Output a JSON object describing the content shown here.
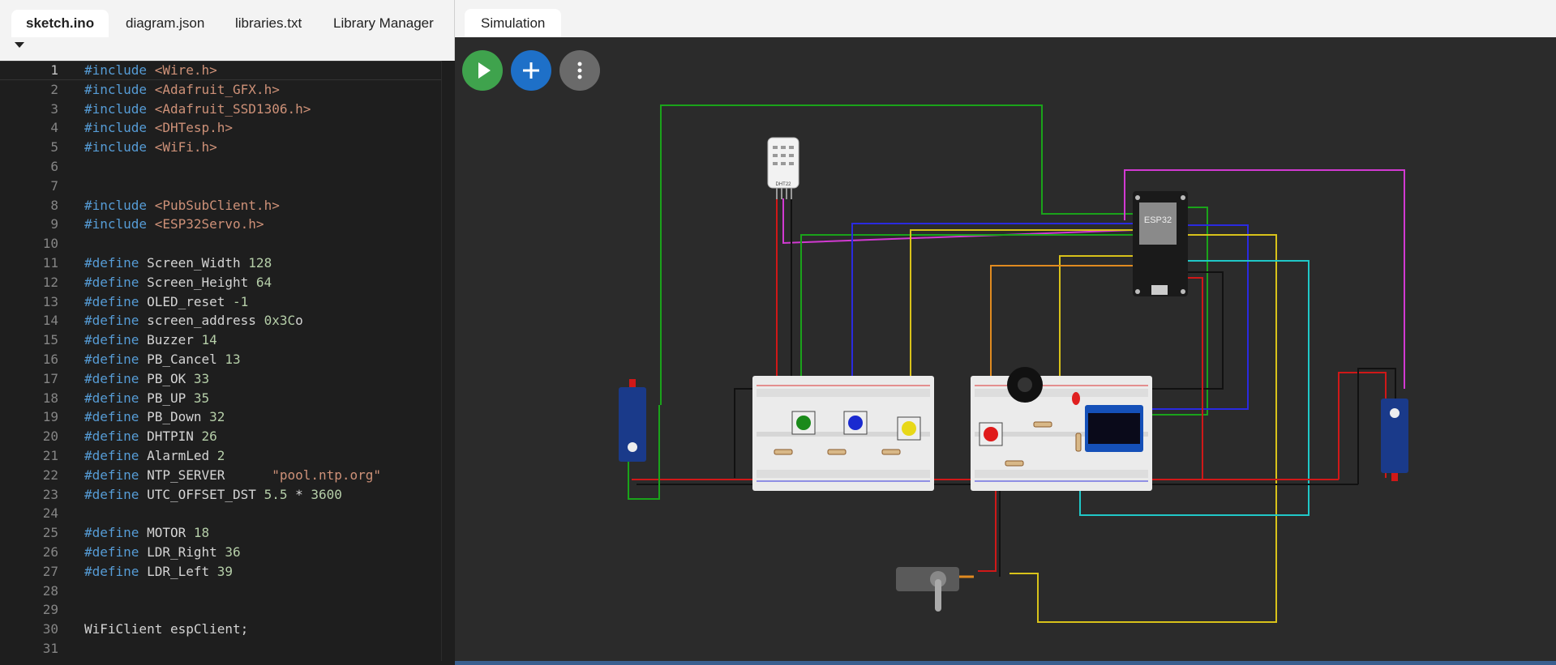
{
  "editor_tabs": [
    "sketch.ino",
    "diagram.json",
    "libraries.txt",
    "Library Manager"
  ],
  "sim_tab": "Simulation",
  "code": [
    [
      [
        "kw",
        "#include "
      ],
      [
        "str",
        "<Wire.h>"
      ]
    ],
    [
      [
        "kw",
        "#include "
      ],
      [
        "str",
        "<Adafruit_GFX.h>"
      ]
    ],
    [
      [
        "kw",
        "#include "
      ],
      [
        "str",
        "<Adafruit_SSD1306.h>"
      ]
    ],
    [
      [
        "kw",
        "#include "
      ],
      [
        "str",
        "<DHTesp.h>"
      ]
    ],
    [
      [
        "kw",
        "#include "
      ],
      [
        "str",
        "<WiFi.h>"
      ]
    ],
    [],
    [],
    [
      [
        "kw",
        "#include "
      ],
      [
        "str",
        "<PubSubClient.h>"
      ]
    ],
    [
      [
        "kw",
        "#include "
      ],
      [
        "str",
        "<ESP32Servo.h>"
      ]
    ],
    [],
    [
      [
        "kw",
        "#define "
      ],
      [
        "id",
        "Screen_Width "
      ],
      [
        "num",
        "128"
      ]
    ],
    [
      [
        "kw",
        "#define "
      ],
      [
        "id",
        "Screen_Height "
      ],
      [
        "num",
        "64"
      ]
    ],
    [
      [
        "kw",
        "#define "
      ],
      [
        "id",
        "OLED_reset "
      ],
      [
        "num",
        "-1"
      ]
    ],
    [
      [
        "kw",
        "#define "
      ],
      [
        "id",
        "screen_address "
      ],
      [
        "num",
        "0x3C"
      ],
      [
        "id",
        "o"
      ]
    ],
    [
      [
        "kw",
        "#define "
      ],
      [
        "id",
        "Buzzer "
      ],
      [
        "num",
        "14"
      ]
    ],
    [
      [
        "kw",
        "#define "
      ],
      [
        "id",
        "PB_Cancel "
      ],
      [
        "num",
        "13"
      ]
    ],
    [
      [
        "kw",
        "#define "
      ],
      [
        "id",
        "PB_OK "
      ],
      [
        "num",
        "33"
      ]
    ],
    [
      [
        "kw",
        "#define "
      ],
      [
        "id",
        "PB_UP "
      ],
      [
        "num",
        "35"
      ]
    ],
    [
      [
        "kw",
        "#define "
      ],
      [
        "id",
        "PB_Down "
      ],
      [
        "num",
        "32"
      ]
    ],
    [
      [
        "kw",
        "#define "
      ],
      [
        "id",
        "DHTPIN "
      ],
      [
        "num",
        "26"
      ]
    ],
    [
      [
        "kw",
        "#define "
      ],
      [
        "id",
        "AlarmLed "
      ],
      [
        "num",
        "2"
      ]
    ],
    [
      [
        "kw",
        "#define "
      ],
      [
        "id",
        "NTP_SERVER      "
      ],
      [
        "str",
        "\"pool.ntp.org\""
      ]
    ],
    [
      [
        "kw",
        "#define "
      ],
      [
        "id",
        "UTC_OFFSET_DST "
      ],
      [
        "num",
        "5.5"
      ],
      [
        "id",
        " * "
      ],
      [
        "num",
        "3600"
      ]
    ],
    [],
    [
      [
        "kw",
        "#define "
      ],
      [
        "id",
        "MOTOR "
      ],
      [
        "num",
        "18"
      ]
    ],
    [
      [
        "kw",
        "#define "
      ],
      [
        "id",
        "LDR_Right "
      ],
      [
        "num",
        "36"
      ]
    ],
    [
      [
        "kw",
        "#define "
      ],
      [
        "id",
        "LDR_Left "
      ],
      [
        "num",
        "39"
      ]
    ],
    [],
    [],
    [
      [
        "id",
        "WiFiClient espClient;"
      ]
    ],
    []
  ],
  "line_numbers": [
    "1",
    "2",
    "3",
    "4",
    "5",
    "6",
    "7",
    "8",
    "9",
    "10",
    "11",
    "12",
    "13",
    "14",
    "15",
    "16",
    "17",
    "18",
    "19",
    "20",
    "21",
    "22",
    "23",
    "24",
    "25",
    "26",
    "27",
    "28",
    "29",
    "30",
    "31"
  ],
  "labels": {
    "dht": "DHT22",
    "esp": "ESP32"
  },
  "icons": {
    "play": "play-icon",
    "add": "plus-icon",
    "more": "more-vertical-icon"
  },
  "colors": {
    "play_btn": "#3fa34d",
    "add_btn": "#1e70c8",
    "more_btn": "#6a6a6a"
  }
}
